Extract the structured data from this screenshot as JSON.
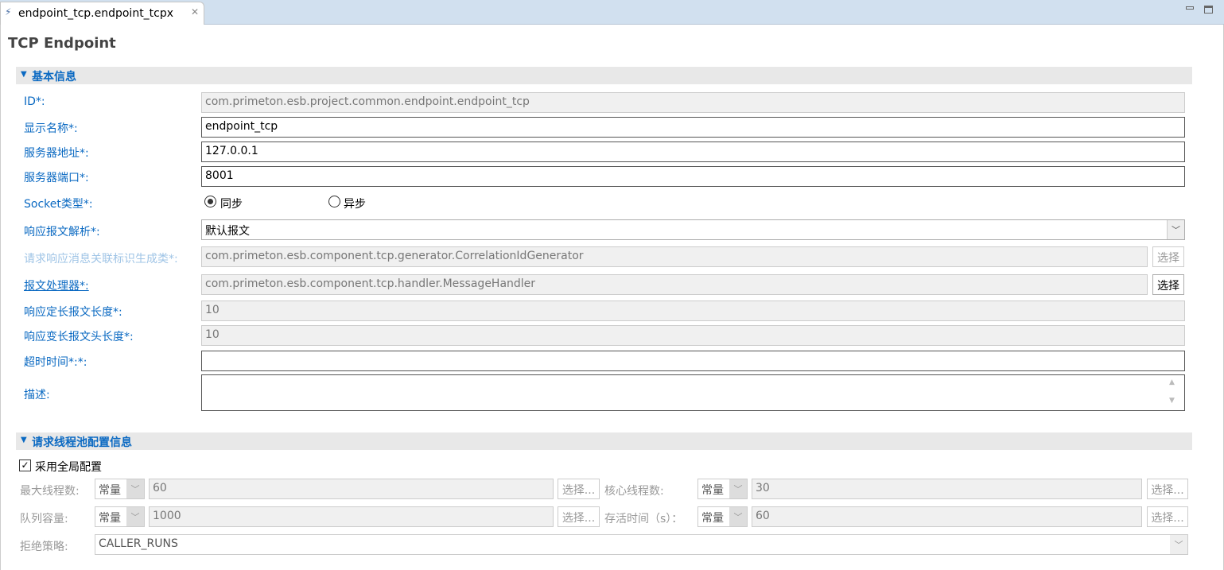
{
  "tab": {
    "title": "endpoint_tcp.endpoint_tcpx"
  },
  "page": {
    "title": "TCP Endpoint"
  },
  "basic": {
    "header": "基本信息",
    "id_label": "ID*:",
    "id_value": "com.primeton.esb.project.common.endpoint.endpoint_tcp",
    "name_label": "显示名称*:",
    "name_value": "endpoint_tcp",
    "addr_label": "服务器地址*:",
    "addr_value": "127.0.0.1",
    "port_label": "服务器端口*:",
    "port_value": "8001",
    "socket_label": "Socket类型*:",
    "sync_label": "同步",
    "async_label": "异步",
    "socket_selected": "同步",
    "parse_label": "响应报文解析*:",
    "parse_value": "默认报文",
    "corr_label": "请求响应消息关联标识生成类*:",
    "corr_value": "com.primeton.esb.component.tcp.generator.CorrelationIdGenerator",
    "corr_button": "选择",
    "handler_label": "报文处理器*:",
    "handler_value": "com.primeton.esb.component.tcp.handler.MessageHandler",
    "handler_button": "选择",
    "fixed_label": "响应定长报文长度*:",
    "fixed_value": "10",
    "var_label": "响应变长报文头长度*:",
    "var_value": "10",
    "timeout_label": "超时时间*:*:",
    "timeout_value": "",
    "desc_label": "描述:",
    "desc_value": ""
  },
  "pool": {
    "header": "请求线程池配置信息",
    "global_label": "采用全局配置",
    "global_checked": true,
    "max_label": "最大线程数:",
    "max_type": "常量",
    "max_value": "60",
    "max_button": "选择...",
    "core_label": "核心线程数:",
    "core_type": "常量",
    "core_value": "30",
    "core_button": "选择...",
    "queue_label": "队列容量:",
    "queue_type": "常量",
    "queue_value": "1000",
    "queue_button": "选择...",
    "alive_label": "存活时间（s）：",
    "alive_type": "常量",
    "alive_value": "60",
    "alive_button": "选择...",
    "reject_label": "拒绝策略:",
    "reject_value": "CALLER_RUNS"
  }
}
